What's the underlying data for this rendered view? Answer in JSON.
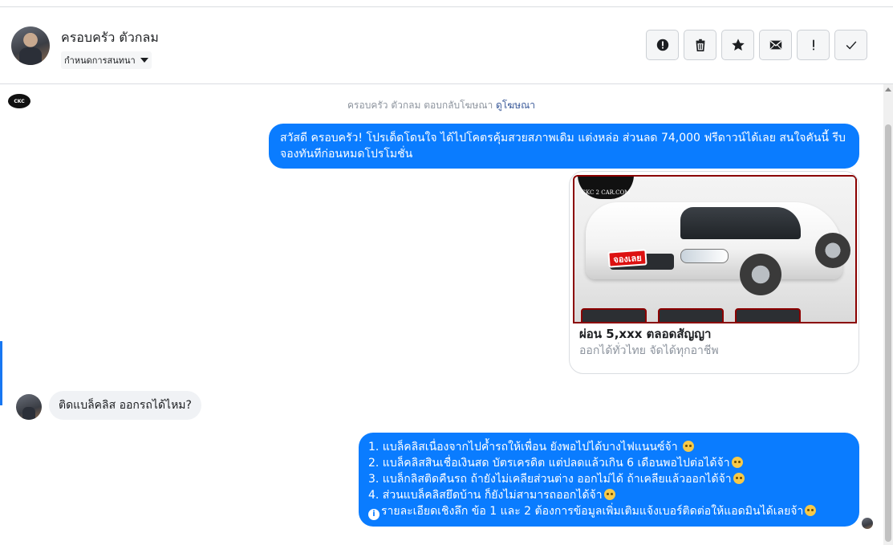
{
  "header": {
    "contact_name": "ครอบครัว ตัวกลม",
    "label_button": "กำหนดการสนทนา",
    "actions": [
      {
        "name": "report-button",
        "icon": "exclamation-circle-icon"
      },
      {
        "name": "delete-button",
        "icon": "trash-icon"
      },
      {
        "name": "star-button",
        "icon": "star-icon"
      },
      {
        "name": "mark-unread-button",
        "icon": "envelope-icon"
      },
      {
        "name": "follow-up-button",
        "icon": "exclamation-icon"
      },
      {
        "name": "done-button",
        "icon": "checkmark-icon"
      }
    ]
  },
  "thread": {
    "page_logo_text": "CKC",
    "ad_reply": {
      "text": "ครอบครัว ตัวกลม ตอบกลับโฆษณา",
      "link": "ดูโฆษณา"
    },
    "message_out_1": "สวัสดี ครอบครัว! โปรเด็ดโดนใจ ได้ไปโคตรคุ้มสวยสภาพเดิม แต่งหล่อ  ส่วนลด 74,000 ฟรีดาวน์ได้เลย  สนใจคันนี้ รีบจองทันทีก่อนหมดโปรโมชั่น",
    "card": {
      "image_logo": "CKC 2 CAR.COM",
      "image_sticker": "จองเลย",
      "title": "ผ่อน 5,xxx ตลอดสัญญา",
      "subtitle": "ออกได้ทั่วไทย จัดได้ทุกอาชีพ"
    },
    "message_in_1": "ติดแบล็คลิส ออกรถได้ไหม?",
    "message_out_2": [
      "1. แบล็คลิสเนื่องจากไปค้ำรถให้เพื่อน ยังพอไปได้บางไฟแนนซ์จ้า",
      "2. แบล็คลิสสินเชื่อเงินสด บัตรเครดิต แต่ปลดแล้วเกิน 6 เดือนพอไปต่อได้จ้า",
      "3. แบล็กลิสติดคืนรถ ถ้ายังไม่เคลียส่วนต่าง ออกไม่ได้ ถ้าเคลียแล้วออกได้จ้า",
      "4. ส่วนแบล็คลิสยึดบ้าน ก็ยังไม่สามารถออกได้จ้า",
      "รายละเอียดเชิงลึก ข้อ 1 และ 2 ต้องการข้อมูลเพิ่มเติมแจ้งเบอร์ติดต่อให้แอดมินได้เลยจ้า"
    ]
  },
  "colors": {
    "outgoing_bubble": "#0a7cff",
    "incoming_bubble": "#f0f2f5",
    "link": "#385898"
  }
}
